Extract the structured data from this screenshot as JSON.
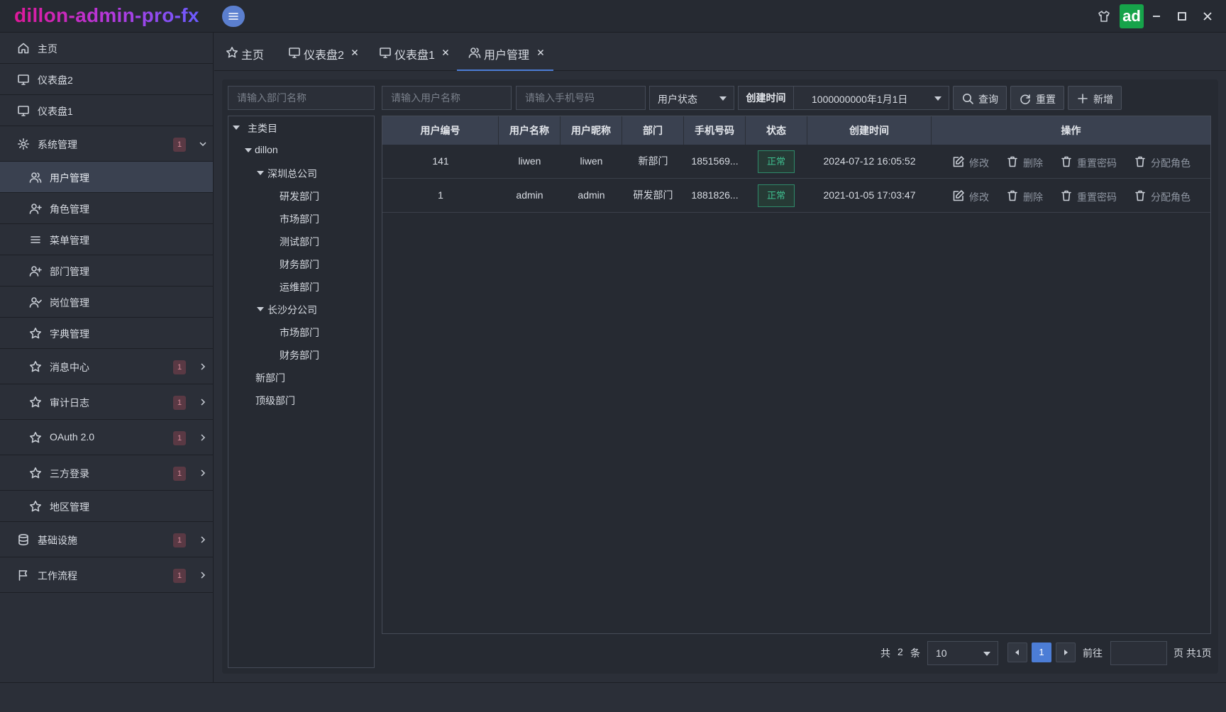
{
  "app": {
    "title": "dillon-admin-pro-fx",
    "avatar_text": "ad"
  },
  "sidebar": {
    "items": [
      {
        "label": "主页",
        "icon": "home-icon"
      },
      {
        "label": "仪表盘2",
        "icon": "monitor-icon"
      },
      {
        "label": "仪表盘1",
        "icon": "monitor-icon"
      },
      {
        "label": "系统管理",
        "icon": "gear-icon",
        "badge": "1"
      },
      {
        "label": "用户管理",
        "icon": "users-icon"
      },
      {
        "label": "角色管理",
        "icon": "user-plus-icon"
      },
      {
        "label": "菜单管理",
        "icon": "menu-icon"
      },
      {
        "label": "部门管理",
        "icon": "user-plus-icon"
      },
      {
        "label": "岗位管理",
        "icon": "user-check-icon"
      },
      {
        "label": "字典管理",
        "icon": "star-icon"
      },
      {
        "label": "消息中心",
        "icon": "star-icon",
        "badge": "1"
      },
      {
        "label": "审计日志",
        "icon": "star-icon",
        "badge": "1"
      },
      {
        "label": "OAuth 2.0",
        "icon": "star-icon",
        "badge": "1"
      },
      {
        "label": "三方登录",
        "icon": "star-icon",
        "badge": "1"
      },
      {
        "label": "地区管理",
        "icon": "star-icon"
      },
      {
        "label": "基础设施",
        "icon": "database-icon",
        "badge": "1"
      },
      {
        "label": "工作流程",
        "icon": "flag-icon",
        "badge": "1"
      }
    ]
  },
  "tabs": [
    {
      "label": "主页",
      "icon": "star-icon"
    },
    {
      "label": "仪表盘2",
      "icon": "monitor-icon"
    },
    {
      "label": "仪表盘1",
      "icon": "monitor-icon"
    },
    {
      "label": "用户管理",
      "icon": "users-icon"
    }
  ],
  "filters": {
    "dept_placeholder": "请输入部门名称",
    "username_placeholder": "请输入用户名称",
    "phone_placeholder": "请输入手机号码",
    "status_label": "用户状态",
    "created_label": "创建时间",
    "created_value": "1000000000年1月1日",
    "query_label": "查询",
    "reset_label": "重置",
    "add_label": "新增"
  },
  "tree": {
    "root": "主类目",
    "nodes": {
      "dillon": "dillon",
      "shenzhen": "深圳总公司",
      "sz_rd": "研发部门",
      "sz_market": "市场部门",
      "sz_test": "测试部门",
      "sz_finance": "财务部门",
      "sz_ops": "运维部门",
      "changsha": "长沙分公司",
      "cs_market": "市场部门",
      "cs_finance": "财务部门",
      "new_dept": "新部门",
      "top_dept": "顶级部门"
    }
  },
  "table": {
    "columns": [
      "用户编号",
      "用户名称",
      "用户昵称",
      "部门",
      "手机号码",
      "状态",
      "创建时间",
      "操作"
    ],
    "rows": [
      {
        "id": "141",
        "username": "liwen",
        "nickname": "liwen",
        "dept": "新部门",
        "phone": "1851569...",
        "status": "正常",
        "created": "2024-07-12 16:05:52"
      },
      {
        "id": "1",
        "username": "admin",
        "nickname": "admin",
        "dept": "研发部门",
        "phone": "1881826...",
        "status": "正常",
        "created": "2021-01-05 17:03:47"
      }
    ],
    "actions": {
      "edit": "修改",
      "delete": "删除",
      "reset_pwd": "重置密码",
      "assign_role": "分配角色"
    }
  },
  "pager": {
    "total_prefix": "共",
    "total": "2",
    "total_suffix": "条",
    "page_size": "10",
    "current_page": "1",
    "goto_label": "前往",
    "page_suffix": "页 共1页"
  }
}
